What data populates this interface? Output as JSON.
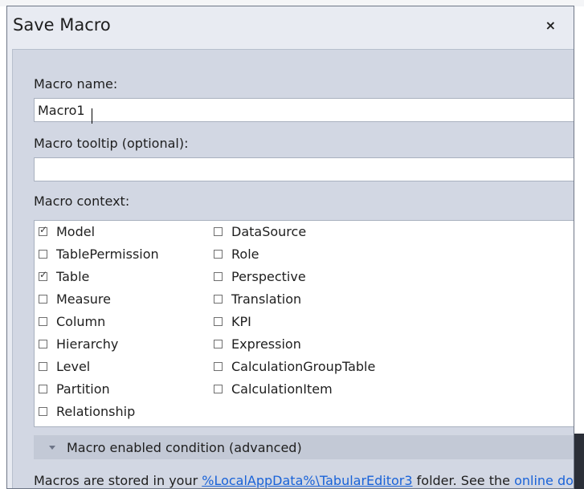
{
  "dialog": {
    "title": "Save Macro",
    "close_glyph": "×"
  },
  "fields": {
    "name_label": "Macro name:",
    "name_value": "Macro1",
    "tooltip_label": "Macro tooltip (optional):",
    "tooltip_value": ""
  },
  "context": {
    "label": "Macro context:",
    "left_items": [
      {
        "label": "Model",
        "checked": true
      },
      {
        "label": "TablePermission",
        "checked": false
      },
      {
        "label": "Table",
        "checked": true
      },
      {
        "label": "Measure",
        "checked": false
      },
      {
        "label": "Column",
        "checked": false
      },
      {
        "label": "Hierarchy",
        "checked": false
      },
      {
        "label": "Level",
        "checked": false
      },
      {
        "label": "Partition",
        "checked": false
      },
      {
        "label": "Relationship",
        "checked": false
      }
    ],
    "right_items": [
      {
        "label": "DataSource",
        "checked": false
      },
      {
        "label": "Role",
        "checked": false
      },
      {
        "label": "Perspective",
        "checked": false
      },
      {
        "label": "Translation",
        "checked": false
      },
      {
        "label": "KPI",
        "checked": false
      },
      {
        "label": "Expression",
        "checked": false
      },
      {
        "label": "CalculationGroupTable",
        "checked": false
      },
      {
        "label": "CalculationItem",
        "checked": false
      }
    ]
  },
  "condition": {
    "label": "Macro enabled condition (advanced)",
    "icon": "collapse-arrow-icon"
  },
  "footer": {
    "prefix": "Macros are stored in your ",
    "path_link": "%LocalAppData%\\TabularEditor3",
    "middle": " folder. See the ",
    "docs_link": "online do"
  },
  "colors": {
    "dialog_bg": "#e8ebf2",
    "content_bg": "#d2d7e3",
    "link": "#1a63d8"
  }
}
